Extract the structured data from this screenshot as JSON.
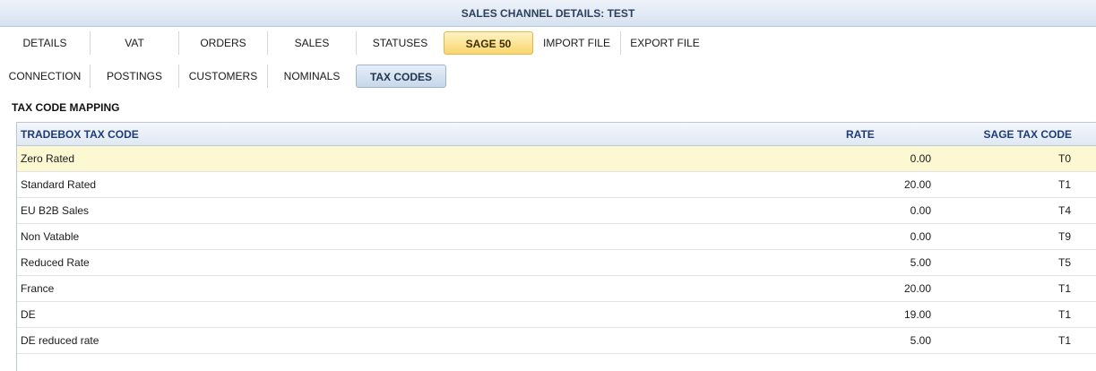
{
  "window": {
    "title": "SALES CHANNEL DETAILS: TEST"
  },
  "main_tabs": [
    {
      "label": "DETAILS",
      "active": false
    },
    {
      "label": "VAT",
      "active": false
    },
    {
      "label": "ORDERS",
      "active": false
    },
    {
      "label": "SALES",
      "active": false
    },
    {
      "label": "STATUSES",
      "active": false
    },
    {
      "label": "SAGE 50",
      "active": true
    },
    {
      "label": "IMPORT FILE",
      "active": false
    },
    {
      "label": "EXPORT FILE",
      "active": false
    }
  ],
  "sub_tabs": [
    {
      "label": "CONNECTION",
      "active": false
    },
    {
      "label": "POSTINGS",
      "active": false
    },
    {
      "label": "CUSTOMERS",
      "active": false
    },
    {
      "label": "NOMINALS",
      "active": false
    },
    {
      "label": "TAX CODES",
      "active": true
    }
  ],
  "section": {
    "title": "TAX CODE MAPPING"
  },
  "table": {
    "columns": [
      "TRADEBOX TAX CODE",
      "RATE",
      "SAGE TAX CODE"
    ],
    "rows": [
      {
        "name": "Zero Rated",
        "rate": "0.00",
        "sage": "T0",
        "selected": true
      },
      {
        "name": "Standard Rated",
        "rate": "20.00",
        "sage": "T1"
      },
      {
        "name": "EU B2B Sales",
        "rate": "0.00",
        "sage": "T4"
      },
      {
        "name": "Non Vatable",
        "rate": "0.00",
        "sage": "T9"
      },
      {
        "name": "Reduced Rate",
        "rate": "5.00",
        "sage": "T5"
      },
      {
        "name": "France",
        "rate": "20.00",
        "sage": "T1"
      },
      {
        "name": "DE",
        "rate": "19.00",
        "sage": "T1"
      },
      {
        "name": "DE reduced rate",
        "rate": "5.00",
        "sage": "T1"
      }
    ]
  },
  "colors": {
    "accent_gold": "#f9d56e",
    "accent_blue": "#c7d7ea",
    "header_text": "#1e3a78",
    "selected_row": "#fbf8d2"
  }
}
